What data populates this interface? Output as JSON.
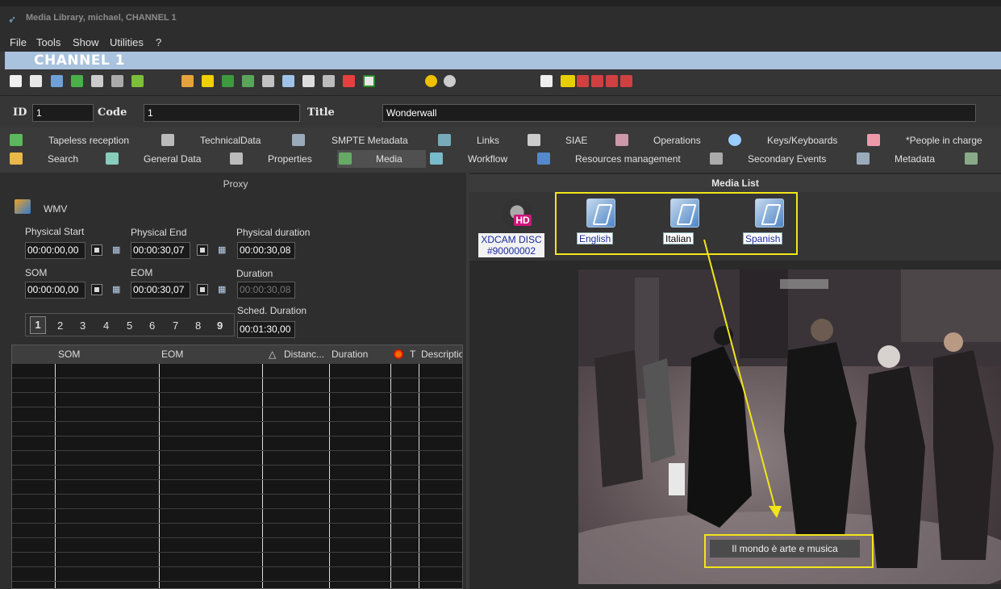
{
  "window": {
    "title": "Media Library, michael, CHANNEL 1"
  },
  "menu": [
    "File",
    "Tools",
    "Show",
    "Utilities",
    "?"
  ],
  "channel": "CHANNEL 1",
  "record": {
    "id_label": "ID",
    "id_value": "1",
    "code_label": "Code",
    "code_value": "1",
    "title_label": "Title",
    "title_value": "Wonderwall"
  },
  "tabs_row1": [
    "Tapeless reception",
    "TechnicalData",
    "SMPTE Metadata",
    "Links",
    "SIAE",
    "Operations",
    "Keys/Keyboards",
    "*People in charge"
  ],
  "tabs_row2": [
    "Search",
    "General Data",
    "Properties",
    "Media",
    "Workflow",
    "Resources management",
    "Secondary Events",
    "Metadata"
  ],
  "active_tab": "Media",
  "proxy": {
    "header": "Proxy",
    "format": "WMV",
    "physical_start_label": "Physical Start",
    "physical_end_label": "Physical End",
    "physical_duration_label": "Physical duration",
    "physical_start": "00:00:00,00",
    "physical_end": "00:00:30,07",
    "physical_duration": "00:00:30,08",
    "som_label": "SOM",
    "eom_label": "EOM",
    "duration_label": "Duration",
    "som": "00:00:00,00",
    "eom": "00:00:30,07",
    "duration": "00:00:30,08",
    "sched_label": "Sched. Duration",
    "sched_duration": "00:01:30,00",
    "pages": [
      "1",
      "2",
      "3",
      "4",
      "5",
      "6",
      "7",
      "8",
      "9"
    ],
    "grid_headers": [
      "SOM",
      "EOM",
      "Distanc...",
      "Duration",
      "T",
      "Descriptio"
    ]
  },
  "media_list": {
    "header": "Media List",
    "disc_label_line1": "XDCAM DISC",
    "disc_label_line2": "#90000002",
    "hd_badge": "HD",
    "languages": [
      "English",
      "Italian",
      "Spanish"
    ],
    "subtitle": "Il mondo è arte e musica"
  },
  "colors": {
    "highlight": "#f2e51a",
    "channel_bar": "#a9c3de"
  }
}
